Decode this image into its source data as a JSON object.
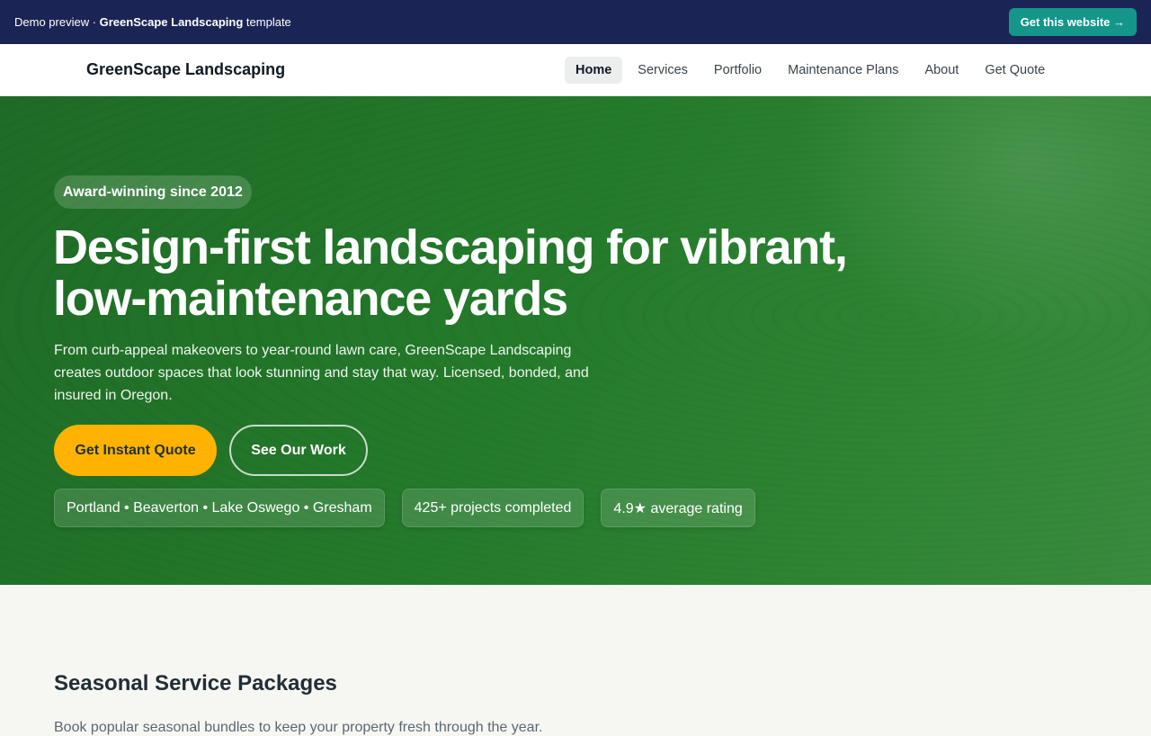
{
  "demo_bar": {
    "prefix": "Demo preview · ",
    "template_name": "GreenScape Landscaping",
    "suffix": " template",
    "cta_label": "Get this website →"
  },
  "nav": {
    "brand": "GreenScape Landscaping",
    "links": [
      {
        "label": "Home",
        "active": true
      },
      {
        "label": "Services",
        "active": false
      },
      {
        "label": "Portfolio",
        "active": false
      },
      {
        "label": "Maintenance Plans",
        "active": false
      },
      {
        "label": "About",
        "active": false
      },
      {
        "label": "Get Quote",
        "active": false
      }
    ]
  },
  "hero": {
    "badge": "Award-winning since 2012",
    "headline": "Design-first landscaping for vibrant, low-maintenance yards",
    "subtext": "From curb-appeal makeovers to year-round lawn care, GreenScape Landscaping creates outdoor spaces that look stunning and stay that way. Licensed, bonded, and insured in Oregon.",
    "primary_cta": "Get Instant Quote",
    "secondary_cta": "See Our Work",
    "stats": [
      "Portland • Beaverton • Lake Oswego • Gresham",
      "425+ projects completed",
      "4.9★ average rating"
    ]
  },
  "packages": {
    "title": "Seasonal Service Packages",
    "subtitle": "Book popular seasonal bundles to keep your property fresh through the year."
  },
  "colors": {
    "demo_bar_bg": "#1a2555",
    "demo_cta_bg": "#14968a",
    "hero_green": "#247a2b",
    "primary_cta_bg": "#ffb300",
    "page_bg": "#f6f7f3"
  }
}
